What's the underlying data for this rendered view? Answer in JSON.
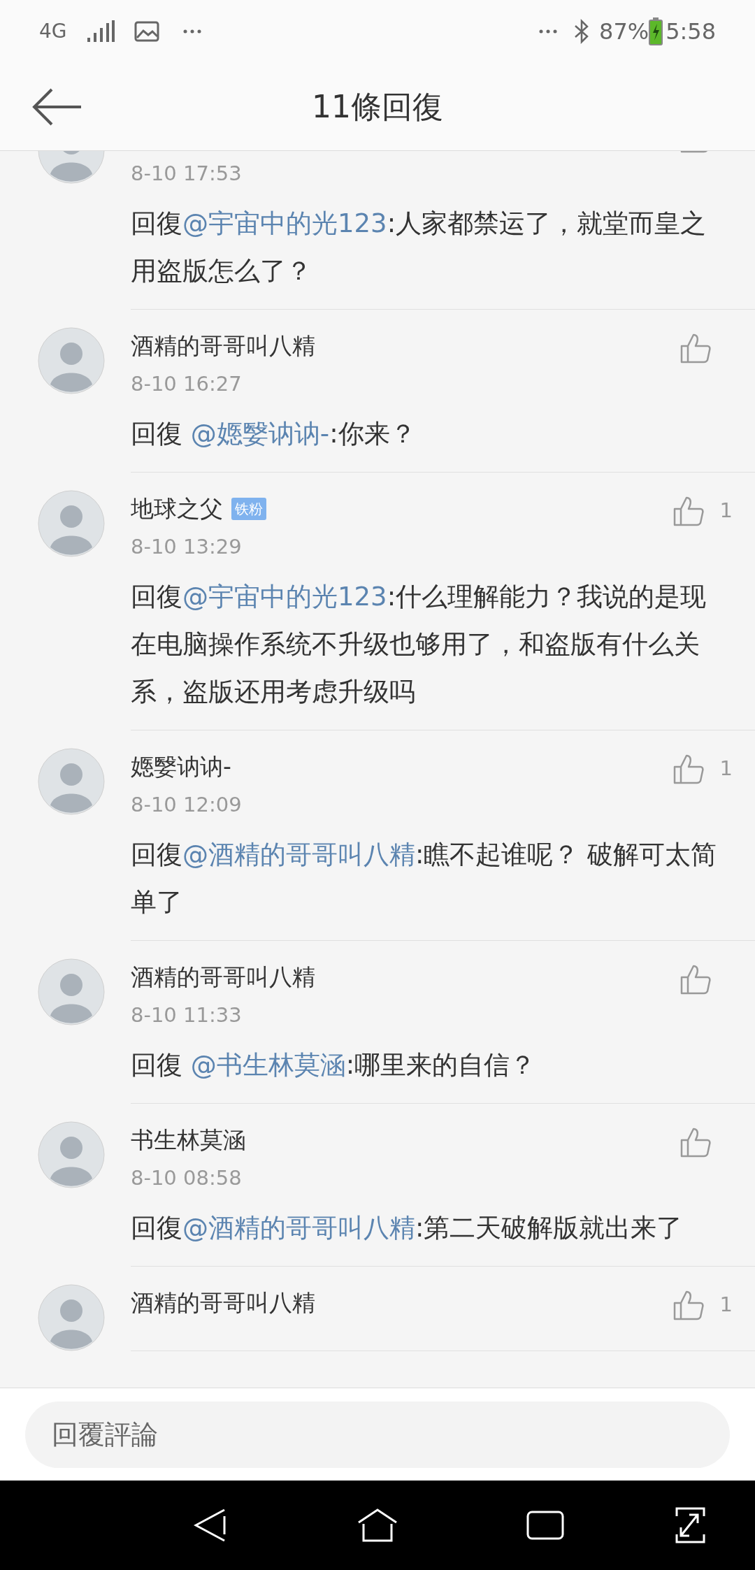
{
  "status_bar": {
    "network": "4G",
    "battery": "87%",
    "time": "5:58"
  },
  "header": {
    "title": "11條回復"
  },
  "comments": [
    {
      "date": "8-10 17:53",
      "prefix": "回復",
      "mention": "@宇宙中的光123",
      "body": ":人家都禁运了，就堂而皇之用盗版怎么了？"
    },
    {
      "name": "酒精的哥哥叫八精",
      "date": "8-10 16:27",
      "prefix": "回復 ",
      "mention": "@嫕嫛讷讷-",
      "body": ":你来？"
    },
    {
      "name": "地球之父",
      "badge": "铁粉",
      "likes": "1",
      "date": "8-10 13:29",
      "prefix": "回復",
      "mention": "@宇宙中的光123",
      "body": ":什么理解能力？我说的是现在电脑操作系统不升级也够用了，和盗版有什么关系，盗版还用考虑升级吗"
    },
    {
      "name": "嫕嫛讷讷-",
      "likes": "1",
      "date": "8-10 12:09",
      "prefix": "回復",
      "mention": "@酒精的哥哥叫八精",
      "body": ":瞧不起谁呢？ 破解可太简单了"
    },
    {
      "name": "酒精的哥哥叫八精",
      "date": "8-10 11:33",
      "prefix": "回復 ",
      "mention": "@书生林莫涵",
      "body": ":哪里来的自信？"
    },
    {
      "name": "书生林莫涵",
      "date": "8-10 08:58",
      "prefix": "回復",
      "mention": "@酒精的哥哥叫八精",
      "body": ":第二天破解版就出来了"
    },
    {
      "name": "酒精的哥哥叫八精",
      "likes": "1"
    }
  ],
  "reply_box": {
    "placeholder": "回覆評論"
  }
}
